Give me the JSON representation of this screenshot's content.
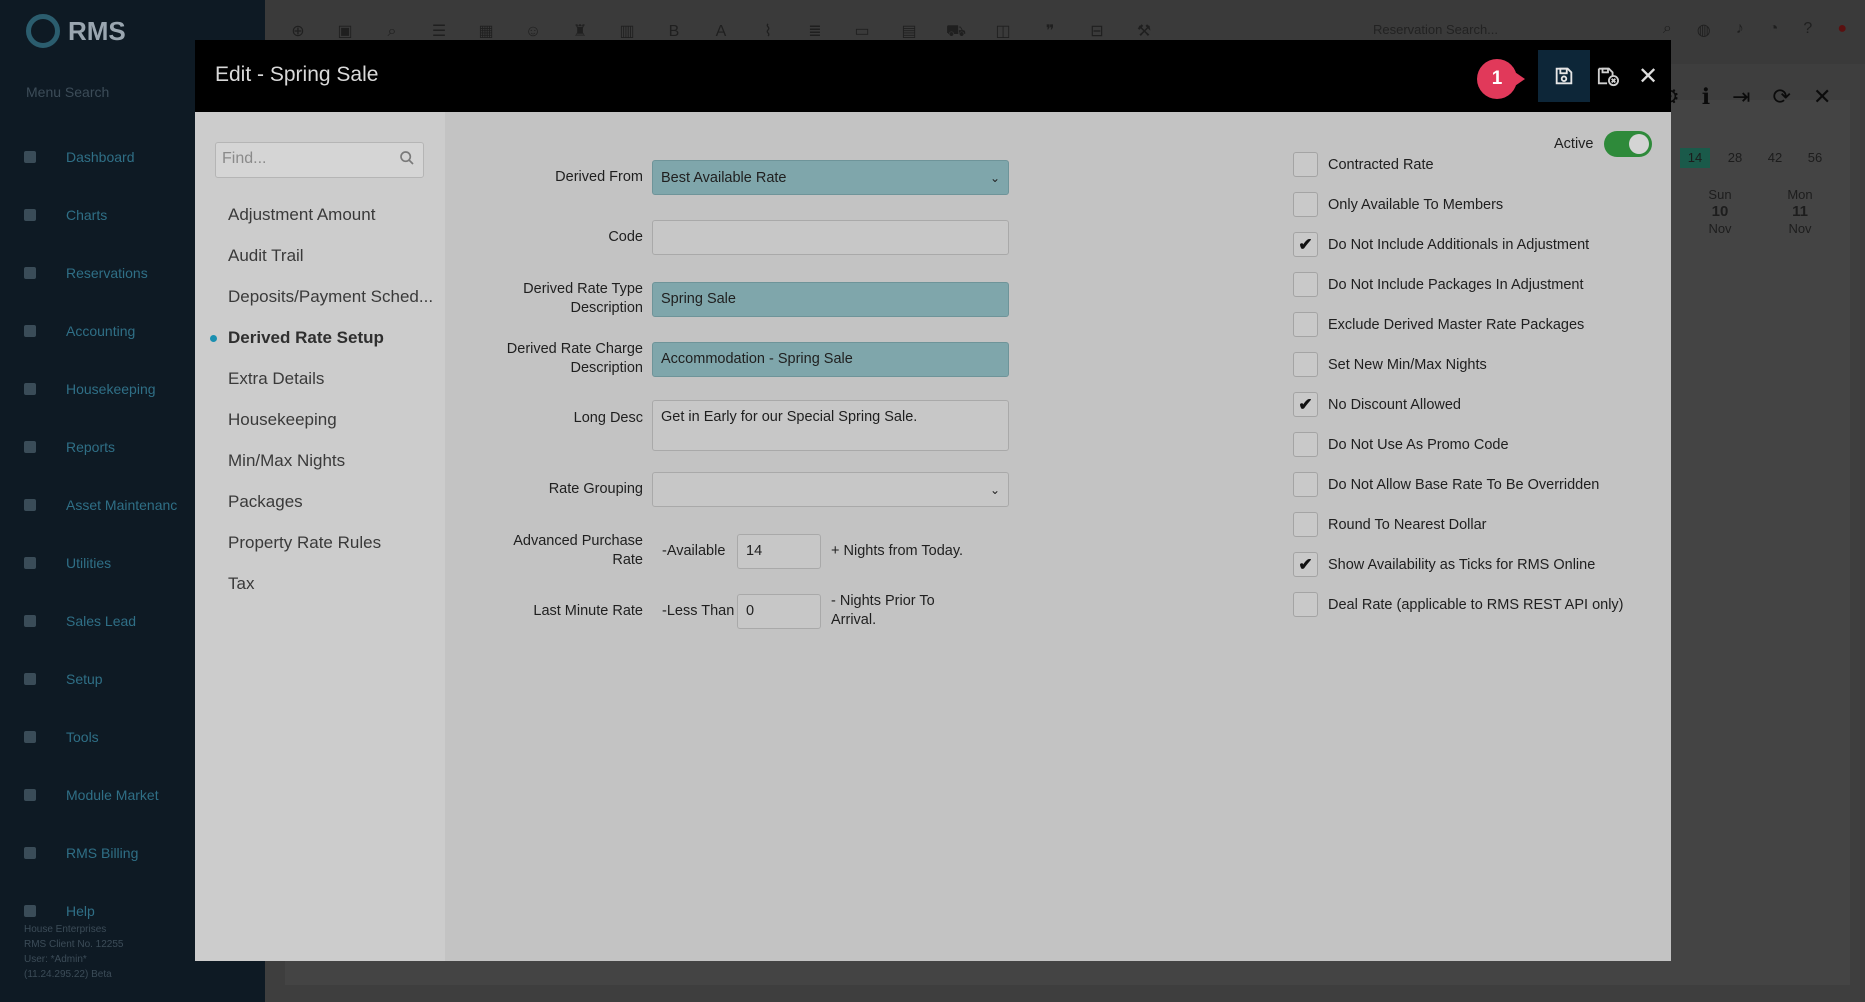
{
  "background": {
    "logo": "RMS",
    "menu_search": "Menu Search",
    "nav": [
      "Dashboard",
      "Charts",
      "Reservations",
      "Accounting",
      "Housekeeping",
      "Reports",
      "Asset Maintenanc",
      "Utilities",
      "Sales Lead",
      "Setup",
      "Tools",
      "Module Market",
      "RMS Billing",
      "Help"
    ],
    "footer": [
      "House Enterprises",
      "RMS Client No. 12255",
      "User: *Admin*",
      "(11.24.295.22) Beta"
    ],
    "reservation_search": "Reservation Search...",
    "day_chips": [
      "14",
      "28",
      "42",
      "56"
    ],
    "calendar": [
      {
        "dow": "Sun",
        "day": "10",
        "month": "Nov"
      },
      {
        "dow": "Mon",
        "day": "11",
        "month": "Nov"
      }
    ]
  },
  "modal": {
    "title": "Edit - Spring Sale",
    "step_badge": "1",
    "find_placeholder": "Find...",
    "left_nav": [
      {
        "label": "Adjustment Amount",
        "active": false
      },
      {
        "label": "Audit Trail",
        "active": false
      },
      {
        "label": "Deposits/Payment Sched...",
        "active": false
      },
      {
        "label": "Derived Rate Setup",
        "active": true
      },
      {
        "label": "Extra Details",
        "active": false
      },
      {
        "label": "Housekeeping",
        "active": false
      },
      {
        "label": "Min/Max Nights",
        "active": false
      },
      {
        "label": "Packages",
        "active": false
      },
      {
        "label": "Property Rate Rules",
        "active": false
      },
      {
        "label": "Tax",
        "active": false
      }
    ],
    "form": {
      "derived_from_label": "Derived From",
      "derived_from_value": "Best Available Rate",
      "code_label": "Code",
      "code_value": "",
      "type_desc_label_1": "Derived Rate Type",
      "type_desc_label_2": "Description",
      "type_desc_value": "Spring Sale",
      "charge_desc_label_1": "Derived Rate Charge",
      "charge_desc_label_2": "Description",
      "charge_desc_value": "Accommodation - Spring Sale",
      "long_desc_label": "Long Desc",
      "long_desc_value": "Get in Early for our Special Spring Sale.",
      "rate_grouping_label": "Rate Grouping",
      "rate_grouping_value": "",
      "adv_purchase_label_1": "Advanced Purchase",
      "adv_purchase_label_2": "Rate",
      "adv_purchase_mini": "-Available",
      "adv_purchase_value": "14",
      "adv_purchase_after": "+ Nights from Today.",
      "last_minute_label": "Last Minute Rate",
      "last_minute_mini": "-Less Than",
      "last_minute_value": "0",
      "last_minute_after_1": "- Nights Prior To",
      "last_minute_after_2": "Arrival."
    },
    "active_label": "Active",
    "active_on": true,
    "checkboxes": [
      {
        "label": "Contracted Rate",
        "checked": false
      },
      {
        "label": "Only Available To Members",
        "checked": false
      },
      {
        "label": "Do Not Include Additionals in Adjustment",
        "checked": true
      },
      {
        "label": "Do Not Include Packages In Adjustment",
        "checked": false
      },
      {
        "label": "Exclude Derived Master Rate Packages",
        "checked": false
      },
      {
        "label": "Set New Min/Max Nights",
        "checked": false
      },
      {
        "label": "No Discount Allowed",
        "checked": true
      },
      {
        "label": "Do Not Use As Promo Code",
        "checked": false
      },
      {
        "label": "Do Not Allow Base Rate To Be Overridden",
        "checked": false
      },
      {
        "label": "Round To Nearest Dollar",
        "checked": false
      },
      {
        "label": "Show Availability as Ticks for RMS Online",
        "checked": true
      },
      {
        "label": "Deal Rate (applicable to RMS REST API only)",
        "checked": false
      }
    ]
  }
}
